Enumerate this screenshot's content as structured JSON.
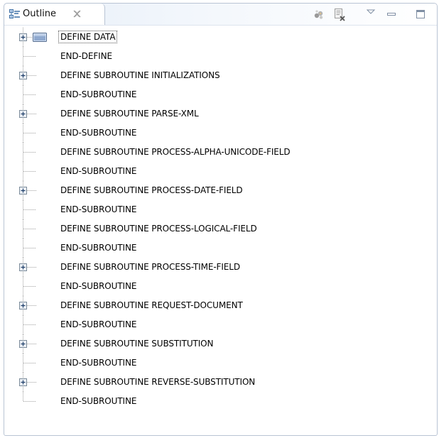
{
  "view": {
    "title": "Outline",
    "icons": {
      "tab": "outline-view-icon",
      "close": "close-icon",
      "toolbar": [
        "hide-fields-icon",
        "collapse-filter-icon",
        "view-menu-icon",
        "minimize-icon",
        "maximize-icon"
      ]
    }
  },
  "tree": {
    "items": [
      {
        "label": "DEFINE DATA",
        "expandable": true,
        "selected": true,
        "icon": "data-block-icon"
      },
      {
        "label": "END-DEFINE",
        "expandable": false
      },
      {
        "label": "DEFINE SUBROUTINE INITIALIZATIONS",
        "expandable": true
      },
      {
        "label": "END-SUBROUTINE",
        "expandable": false
      },
      {
        "label": "DEFINE SUBROUTINE PARSE-XML",
        "expandable": true
      },
      {
        "label": "END-SUBROUTINE",
        "expandable": false
      },
      {
        "label": "DEFINE SUBROUTINE PROCESS-ALPHA-UNICODE-FIELD",
        "expandable": false
      },
      {
        "label": "END-SUBROUTINE",
        "expandable": false
      },
      {
        "label": "DEFINE SUBROUTINE PROCESS-DATE-FIELD",
        "expandable": true
      },
      {
        "label": "END-SUBROUTINE",
        "expandable": false
      },
      {
        "label": "DEFINE SUBROUTINE PROCESS-LOGICAL-FIELD",
        "expandable": false
      },
      {
        "label": "END-SUBROUTINE",
        "expandable": false
      },
      {
        "label": "DEFINE SUBROUTINE PROCESS-TIME-FIELD",
        "expandable": true
      },
      {
        "label": "END-SUBROUTINE",
        "expandable": false
      },
      {
        "label": "DEFINE SUBROUTINE REQUEST-DOCUMENT",
        "expandable": true
      },
      {
        "label": "END-SUBROUTINE",
        "expandable": false
      },
      {
        "label": "DEFINE SUBROUTINE SUBSTITUTION",
        "expandable": true
      },
      {
        "label": "END-SUBROUTINE",
        "expandable": false
      },
      {
        "label": "DEFINE SUBROUTINE REVERSE-SUBSTITUTION",
        "expandable": true
      },
      {
        "label": "END-SUBROUTINE",
        "expandable": false
      }
    ]
  }
}
